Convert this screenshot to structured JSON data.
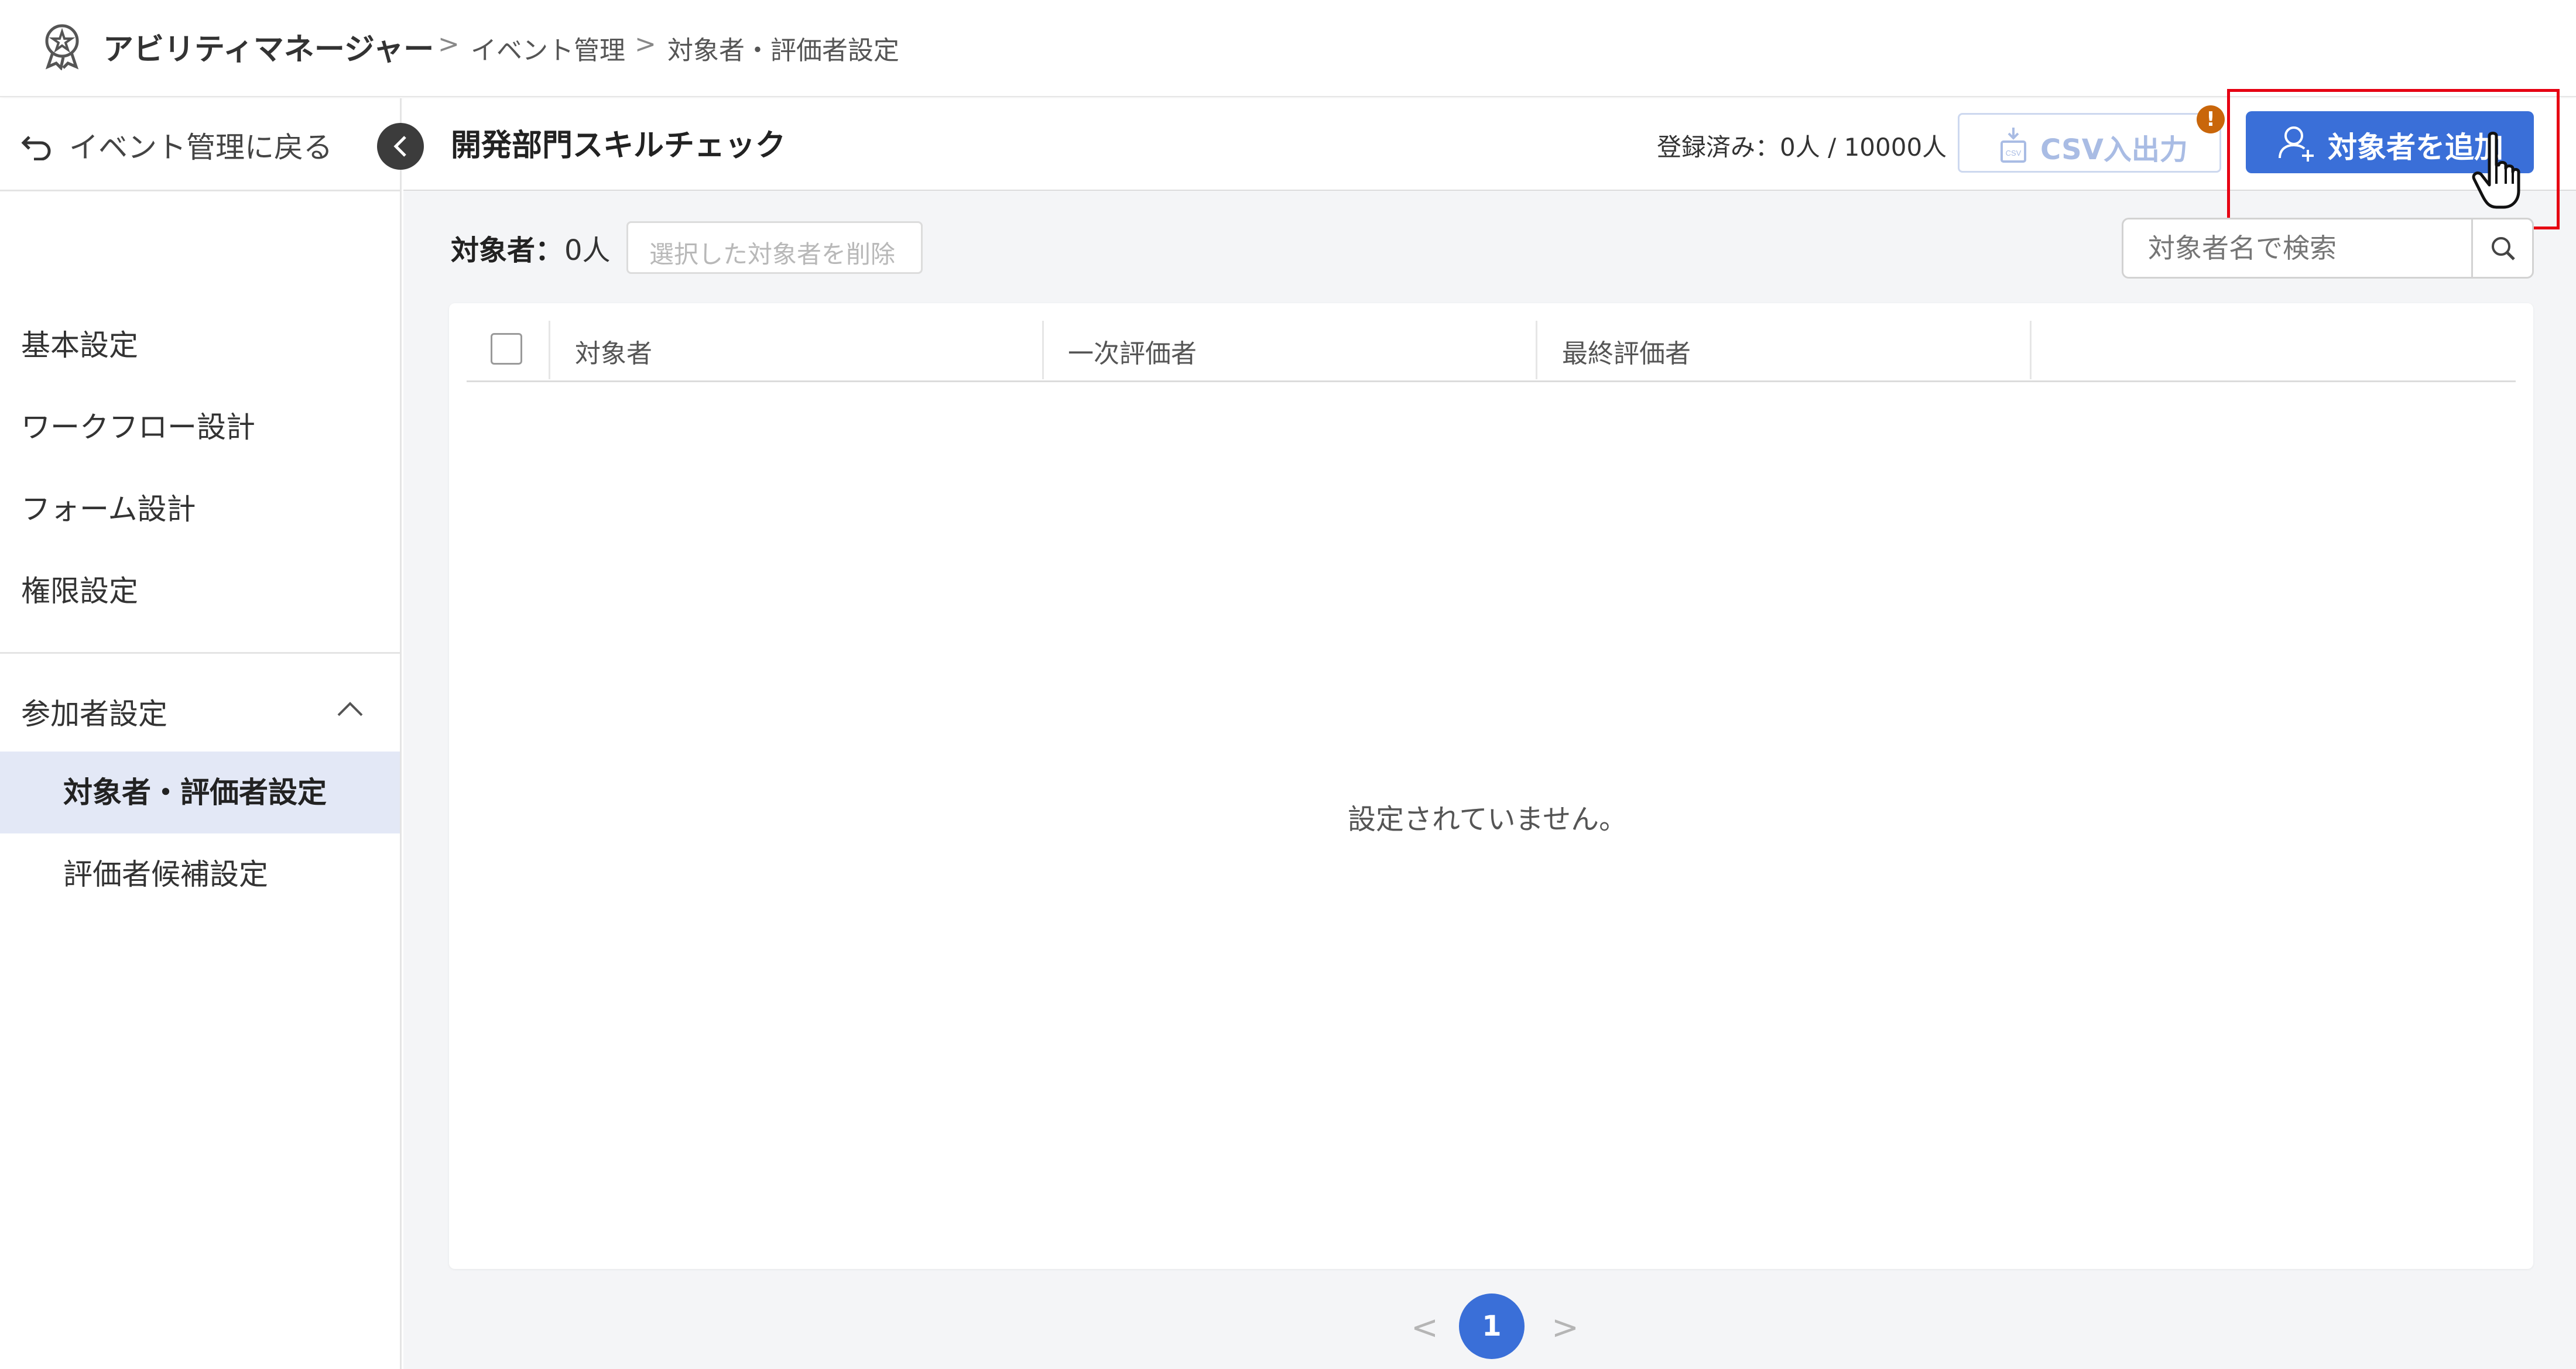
{
  "app": {
    "name": "アビリティマネージャー"
  },
  "breadcrumb": {
    "sep": ">",
    "items": [
      "イベント管理",
      "対象者・評価者設定"
    ]
  },
  "sidebar": {
    "back_label": "イベント管理に戻る",
    "items": [
      {
        "label": "基本設定"
      },
      {
        "label": "ワークフロー設計"
      },
      {
        "label": "フォーム設計"
      },
      {
        "label": "権限設定"
      }
    ],
    "group": {
      "label": "参加者設定",
      "items": [
        {
          "label": "対象者・評価者設定",
          "active": true
        },
        {
          "label": "評価者候補設定"
        }
      ]
    }
  },
  "header": {
    "title": "開発部門スキルチェック",
    "registered": "登録済み：0人 / 10000人",
    "csv_label": "CSV入出力",
    "add_label": "対象者を追加",
    "badge": "!"
  },
  "toolbar": {
    "count_label": "対象者：",
    "count_value": "0人",
    "delete_label": "選択した対象者を削除",
    "search_placeholder": "対象者名で検索"
  },
  "table": {
    "columns": [
      "対象者",
      "一次評価者",
      "最終評価者"
    ],
    "empty_text": "設定されていません。"
  },
  "pagination": {
    "prev": "<",
    "current": "1",
    "next": ">"
  },
  "colors": {
    "accent": "#3a6fd8",
    "highlight": "#e60012",
    "badge": "#c9660a",
    "active_bg": "#e3e8f6"
  }
}
